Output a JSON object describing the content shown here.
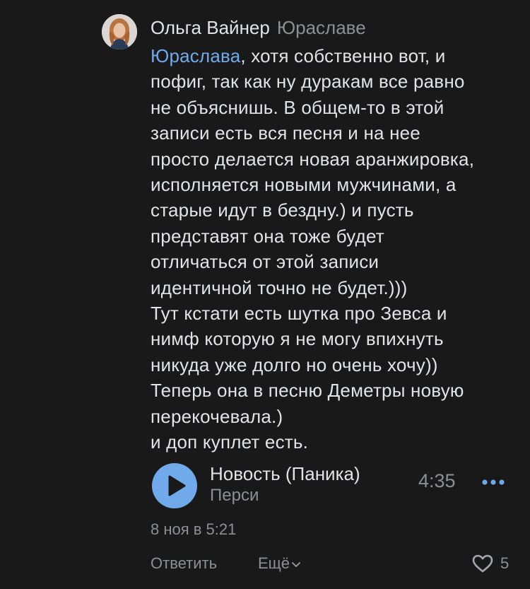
{
  "comment": {
    "author": "Ольга Вайнер",
    "reply_to": "Юраславе",
    "mention": "Юраслава",
    "text_lines": [
      ", хотя собственно вот, и",
      "пофиг, так как ну дуракам все равно",
      "не объяснишь. В общем-то в этой",
      "записи есть вся песня и на нее",
      "просто делается новая аранжировка,",
      "исполняется новыми мужчинами, а",
      "старые идут в бездну.) и пусть",
      "представят она тоже будет",
      "отличаться от этой записи",
      "идентичной точно не будет.)))",
      "Тут кстати есть шутка про Зевса и",
      "нимф которую я не могу впихнуть",
      "никуда уже долго но очень хочу))",
      "Теперь она в песню Деметры новую",
      "перекочевала.)",
      "и доп куплет есть."
    ],
    "audio": {
      "title": "Новость (Паника)",
      "artist": "Перси",
      "duration": "4:35",
      "play_icon": "play-icon",
      "more_icon": "more-dots-icon"
    },
    "timestamp": "8 ноя в 5:21",
    "actions": {
      "reply_label": "Ответить",
      "more_label": "Ещё",
      "like_count": "5"
    }
  },
  "colors": {
    "background": "#19191a",
    "text_primary": "#e1e3e6",
    "text_secondary": "#8c8f94",
    "accent": "#71aaeb"
  }
}
